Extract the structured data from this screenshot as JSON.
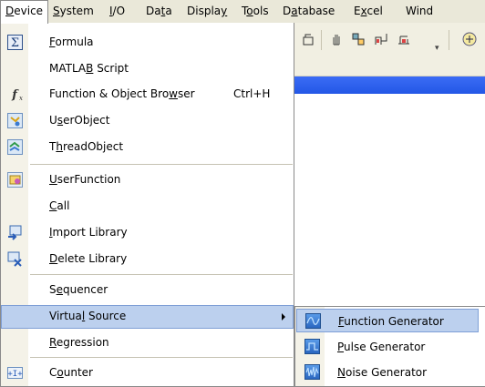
{
  "menubar": {
    "items": [
      {
        "pre": "",
        "key": "D",
        "post": "evice"
      },
      {
        "pre": "",
        "key": "S",
        "post": "ystem"
      },
      {
        "pre": "",
        "key": "I",
        "post": "/O"
      },
      {
        "pre": "Da",
        "key": "t",
        "post": "a"
      },
      {
        "pre": "Displa",
        "key": "y",
        "post": ""
      },
      {
        "pre": "T",
        "key": "o",
        "post": "ols"
      },
      {
        "pre": "D",
        "key": "a",
        "post": "tabase"
      },
      {
        "pre": "E",
        "key": "x",
        "post": "cel"
      },
      {
        "pre": "Wind",
        "key": "",
        "post": ""
      }
    ]
  },
  "device_menu": {
    "items": [
      {
        "pre": "",
        "key": "F",
        "post": "ormula",
        "shortcut": "",
        "icon": "sigma-icon"
      },
      {
        "pre": "MATLA",
        "key": "B",
        "post": " Script",
        "shortcut": "",
        "icon": ""
      },
      {
        "pre": "Function & Object Bro",
        "key": "w",
        "post": "ser",
        "shortcut": "Ctrl+H",
        "icon": "function-icon"
      },
      {
        "pre": "U",
        "key": "s",
        "post": "erObject",
        "shortcut": "",
        "icon": "userobject-icon"
      },
      {
        "pre": "T",
        "key": "h",
        "post": "readObject",
        "shortcut": "",
        "icon": "threadobject-icon"
      },
      {
        "pre": "",
        "key": "U",
        "post": "serFunction",
        "shortcut": "",
        "icon": "userfunction-icon"
      },
      {
        "pre": "",
        "key": "C",
        "post": "all",
        "shortcut": "",
        "icon": ""
      },
      {
        "pre": "",
        "key": "I",
        "post": "mport Library",
        "shortcut": "",
        "icon": "import-library-icon"
      },
      {
        "pre": "",
        "key": "D",
        "post": "elete Library",
        "shortcut": "",
        "icon": "delete-library-icon"
      },
      {
        "pre": "S",
        "key": "e",
        "post": "quencer",
        "shortcut": "",
        "icon": ""
      },
      {
        "pre": "Virtua",
        "key": "l",
        "post": " Source",
        "shortcut": "",
        "icon": ""
      },
      {
        "pre": "",
        "key": "R",
        "post": "egression",
        "shortcut": "",
        "icon": ""
      },
      {
        "pre": "C",
        "key": "o",
        "post": "unter",
        "shortcut": "",
        "icon": "counter-icon"
      }
    ]
  },
  "virtual_source_submenu": {
    "items": [
      {
        "pre": "",
        "key": "F",
        "post": "unction Generator",
        "icon": "function-generator-icon"
      },
      {
        "pre": "",
        "key": "P",
        "post": "ulse Generator",
        "icon": "pulse-generator-icon"
      },
      {
        "pre": "",
        "key": "N",
        "post": "oise Generator",
        "icon": "noise-generator-icon"
      }
    ]
  },
  "colors": {
    "highlight": "#bcd0ee",
    "highlight_border": "#7f9fd6",
    "title_bar": "#2357e6",
    "menubar": "#eae8d9"
  }
}
